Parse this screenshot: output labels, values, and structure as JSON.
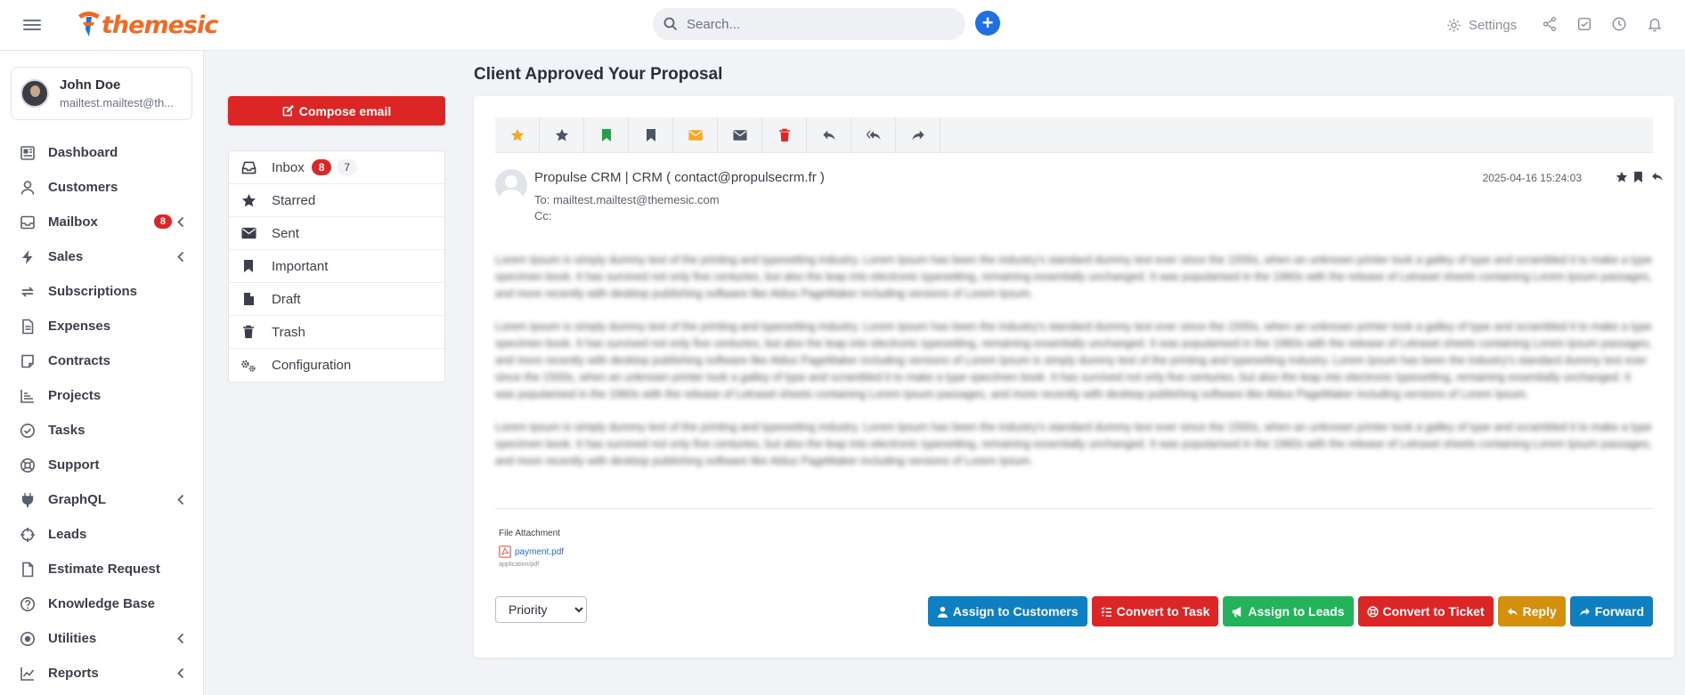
{
  "brand": {
    "name": "themesic",
    "logo_color": "#f26a21"
  },
  "search": {
    "placeholder": "Search..."
  },
  "header": {
    "settings_label": "Settings"
  },
  "user": {
    "name": "John Doe",
    "email": "mailtest.mailtest@th..."
  },
  "nav": [
    {
      "label": "Dashboard",
      "icon": "dashboard-icon"
    },
    {
      "label": "Customers",
      "icon": "user-icon"
    },
    {
      "label": "Mailbox",
      "icon": "inbox-icon",
      "badge": "8",
      "chevron": true
    },
    {
      "label": "Sales",
      "icon": "bolt-icon",
      "chevron": true
    },
    {
      "label": "Subscriptions",
      "icon": "refresh-icon"
    },
    {
      "label": "Expenses",
      "icon": "document-icon"
    },
    {
      "label": "Contracts",
      "icon": "contract-icon"
    },
    {
      "label": "Projects",
      "icon": "chart-icon"
    },
    {
      "label": "Tasks",
      "icon": "check-circle-icon"
    },
    {
      "label": "Support",
      "icon": "lifebuoy-icon"
    },
    {
      "label": "GraphQL",
      "icon": "plug-icon",
      "chevron": true
    },
    {
      "label": "Leads",
      "icon": "crosshair-icon"
    },
    {
      "label": "Estimate Request",
      "icon": "file-icon"
    },
    {
      "label": "Knowledge Base",
      "icon": "question-icon"
    },
    {
      "label": "Utilities",
      "icon": "dot-circle-icon",
      "chevron": true
    },
    {
      "label": "Reports",
      "icon": "line-chart-icon",
      "chevron": true
    }
  ],
  "compose": {
    "label": "Compose email"
  },
  "folders": {
    "inbox": {
      "label": "Inbox",
      "unread": "8",
      "total": "7"
    },
    "starred": {
      "label": "Starred"
    },
    "sent": {
      "label": "Sent"
    },
    "important": {
      "label": "Important"
    },
    "draft": {
      "label": "Draft"
    },
    "trash": {
      "label": "Trash"
    },
    "configuration": {
      "label": "Configuration"
    }
  },
  "email": {
    "title": "Client Approved Your Proposal",
    "sender": "Propulse CRM | CRM ( contact@propulsecrm.fr )",
    "to": "To: mailtest.mailtest@themesic.com",
    "cc": "Cc:",
    "date": "2025-04-16 15:24:03",
    "body": [
      "Lorem Ipsum is simply dummy text of the printing and typesetting industry. Lorem Ipsum has been the industry's standard dummy text ever since the 1500s, when an unknown printer took a galley of type and scrambled it to make a type specimen book. It has survived not only five centuries, but also the leap into electronic typesetting, remaining essentially unchanged. It was popularised in the 1960s with the release of Letraset sheets containing Lorem Ipsum passages, and more recently with desktop publishing software like Aldus PageMaker including versions of Lorem Ipsum.",
      "Lorem Ipsum is simply dummy text of the printing and typesetting industry. Lorem Ipsum has been the industry's standard dummy text ever since the 1500s, when an unknown printer took a galley of type and scrambled it to make a type specimen book. It has survived not only five centuries, but also the leap into electronic typesetting, remaining essentially unchanged. It was popularised in the 1960s with the release of Letraset sheets containing Lorem Ipsum passages, and more recently with desktop publishing software like Aldus PageMaker including versions of Lorem Ipsum is simply dummy text of the printing and typesetting industry. Lorem Ipsum has been the industry's standard dummy text ever since the 1500s, when an unknown printer took a galley of type and scrambled it to make a type specimen book. It has survived not only five centuries, but also the leap into electronic typesetting, remaining essentially unchanged. It was popularised in the 1960s with the release of Letraset sheets containing Lorem Ipsum passages, and more recently with desktop publishing software like Aldus PageMaker including versions of Lorem Ipsum.",
      "Lorem Ipsum is simply dummy text of the printing and typesetting industry. Lorem Ipsum has been the industry's standard dummy text ever since the 1500s, when an unknown printer took a galley of type and scrambled it to make a type specimen book. It has survived not only five centuries, but also the leap into electronic typesetting, remaining essentially unchanged. It was popularised in the 1960s with the release of Letraset sheets containing Lorem Ipsum passages, and more recently with desktop publishing software like Aldus PageMaker including versions of Lorem Ipsum."
    ],
    "attachment_label": "File Attachment",
    "attachment_name": "payment.pdf",
    "attachment_type": "application/pdf",
    "priority_value": "Priority"
  },
  "actions": [
    {
      "label": "Assign to Customers",
      "color": "#0e7fc0",
      "icon": "user-icon"
    },
    {
      "label": "Convert to Task",
      "color": "#dc2626",
      "icon": "tasks-icon"
    },
    {
      "label": "Assign to Leads",
      "color": "#22b35b",
      "icon": "megaphone-icon"
    },
    {
      "label": "Convert to Ticket",
      "color": "#dc2626",
      "icon": "lifebuoy-icon"
    },
    {
      "label": "Reply",
      "color": "#d4900b",
      "icon": "reply-icon"
    },
    {
      "label": "Forward",
      "color": "#0e7fc0",
      "icon": "forward-icon"
    }
  ],
  "toolbar_colors": {
    "star_active": "#f5a623",
    "star": "#4b5563",
    "bookmark_green": "#22a34a",
    "bookmark": "#4b5563",
    "envelope_orange": "#f5a623",
    "envelope": "#4b5563",
    "trash": "#dc2626",
    "reply": "#4b5563"
  }
}
